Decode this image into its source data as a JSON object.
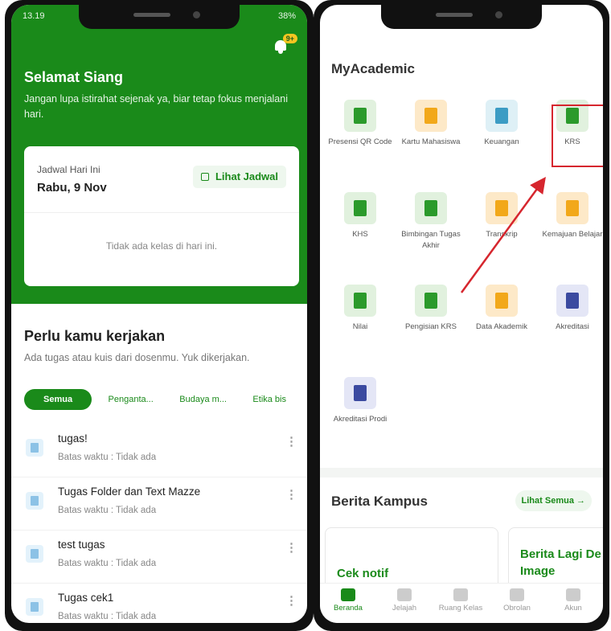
{
  "left": {
    "status": {
      "time": "13.19",
      "battery": "38%"
    },
    "notification_badge": "9+",
    "greeting": "Selamat Siang",
    "greeting_sub": "Jangan lupa istirahat sejenak ya, biar tetap fokus menjalani hari.",
    "schedule": {
      "label": "Jadwal Hari Ini",
      "date": "Rabu, 9 Nov",
      "button": "Lihat Jadwal",
      "empty": "Tidak ada kelas di hari ini."
    },
    "todo": {
      "title": "Perlu kamu kerjakan",
      "subtitle": "Ada tugas atau kuis dari dosenmu. Yuk dikerjakan.",
      "chips": [
        "Semua",
        "Penganta...",
        "Budaya m...",
        "Etika bis"
      ],
      "tasks": [
        {
          "title": "tugas!",
          "deadline": "Batas waktu : Tidak ada"
        },
        {
          "title": "Tugas Folder dan Text Mazze",
          "deadline": "Batas waktu : Tidak ada"
        },
        {
          "title": "test tugas",
          "deadline": "Batas waktu : Tidak ada"
        },
        {
          "title": "Tugas cek1",
          "deadline": "Batas waktu : Tidak ada"
        }
      ]
    }
  },
  "right": {
    "title": "MyAcademic",
    "menu": [
      {
        "label": "Presensi QR Code",
        "color": "green",
        "icon": "qr-icon"
      },
      {
        "label": "Kartu Mahasiswa",
        "color": "orange",
        "icon": "id-card-icon"
      },
      {
        "label": "Keuangan",
        "color": "blue",
        "icon": "finance-icon"
      },
      {
        "label": "KRS",
        "color": "green",
        "icon": "krs-icon"
      },
      {
        "label": "KHS",
        "color": "green",
        "icon": "khs-icon"
      },
      {
        "label": "Bimbingan Tugas Akhir",
        "color": "green",
        "icon": "guidance-icon"
      },
      {
        "label": "Transkrip",
        "color": "orange",
        "icon": "transcript-icon"
      },
      {
        "label": "Kemajuan Belajar",
        "color": "orange",
        "icon": "progress-icon"
      },
      {
        "label": "Nilai",
        "color": "green",
        "icon": "grade-icon"
      },
      {
        "label": "Pengisian KRS",
        "color": "green",
        "icon": "krs-fill-icon"
      },
      {
        "label": "Data Akademik",
        "color": "orange",
        "icon": "academic-data-icon"
      },
      {
        "label": "Akreditasi",
        "color": "purple",
        "icon": "accreditation-icon"
      },
      {
        "label": "Akreditasi Prodi",
        "color": "purple",
        "icon": "prodi-accreditation-icon"
      }
    ],
    "news": {
      "title": "Berita Kampus",
      "see_all": "Lihat Semua",
      "items": [
        "Cek notif",
        "Berita Lagi De Image"
      ]
    },
    "nav": [
      {
        "label": "Beranda",
        "icon": "home-icon",
        "active": true
      },
      {
        "label": "Jelajah",
        "icon": "rocket-icon",
        "active": false
      },
      {
        "label": "Ruang Kelas",
        "icon": "classroom-icon",
        "active": false
      },
      {
        "label": "Obrolan",
        "icon": "chat-icon",
        "active": false
      },
      {
        "label": "Akun",
        "icon": "account-icon",
        "active": false
      }
    ]
  },
  "colors": {
    "primary": "#1a8a1a",
    "highlight": "#d6262e",
    "badge": "#f6c521"
  }
}
